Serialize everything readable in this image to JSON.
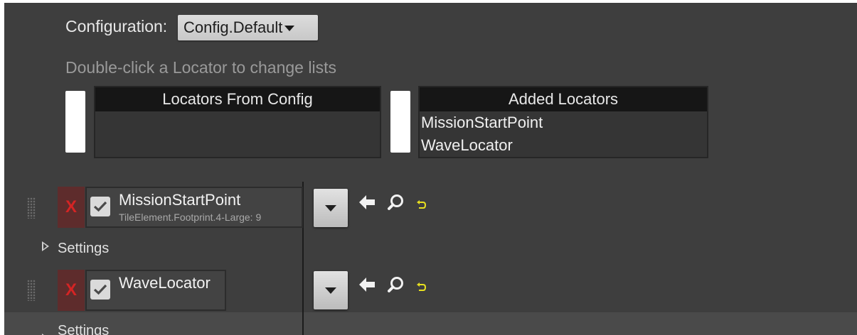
{
  "config": {
    "label": "Configuration:",
    "selected": "Config.Default"
  },
  "hint": "Double-click a Locator to change lists",
  "lists": {
    "from_config": {
      "header": "Locators From Config",
      "items": []
    },
    "added": {
      "header": "Added Locators",
      "items": [
        "MissionStartPoint",
        "WaveLocator"
      ]
    }
  },
  "rows": [
    {
      "title": "MissionStartPoint",
      "subtitle": "TileElement.Footprint.4-Large: 9",
      "remove_label": "X",
      "settings_label": "Settings"
    },
    {
      "title": "WaveLocator",
      "subtitle": "",
      "remove_label": "X",
      "settings_label": "Settings"
    }
  ],
  "icons": {
    "grip": "drag-handle-icon",
    "check": "checkmark-icon",
    "back": "arrow-left-icon",
    "search": "magnifier-icon",
    "reset": "reset-arrow-icon"
  },
  "colors": {
    "panel_bg": "#3e3e3e",
    "remove_red": "#d42424",
    "reset_yellow": "#e8e020"
  }
}
